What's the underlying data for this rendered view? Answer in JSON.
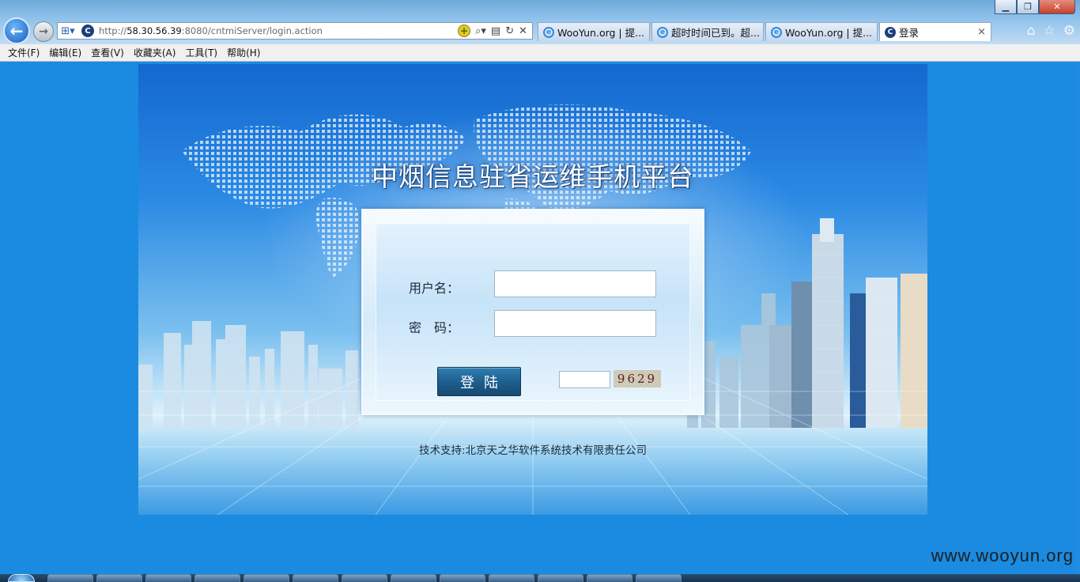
{
  "browser": {
    "url_prefix": "http://",
    "url_host": "58.30.56.39",
    "url_rest": ":8080/cntmiServer/login.action",
    "tabs": [
      {
        "label": "WooYun.org | 提...",
        "icon": "ie-icon"
      },
      {
        "label": "超时时间已到。超...",
        "icon": "ie-icon"
      },
      {
        "label": "WooYun.org | 提...",
        "icon": "ie-icon"
      },
      {
        "label": "登录",
        "icon": "site-icon",
        "active": true
      }
    ],
    "tab_close": "×",
    "menu": [
      "文件(F)",
      "编辑(E)",
      "查看(V)",
      "收藏夹(A)",
      "工具(T)",
      "帮助(H)"
    ]
  },
  "page": {
    "title": "中烟信息驻省运维手机平台",
    "username_label": "用户名：",
    "password_label": "密　码：",
    "username_value": "",
    "password_value": "",
    "login_button": "登陆",
    "captcha_input_value": "",
    "captcha_text": "9629",
    "support": "技术支持:北京天之华软件系统技术有限责任公司"
  },
  "watermark": "www.wooyun.org",
  "colors": {
    "page_background": "#1a8be0",
    "button": "#1e5f8e"
  }
}
